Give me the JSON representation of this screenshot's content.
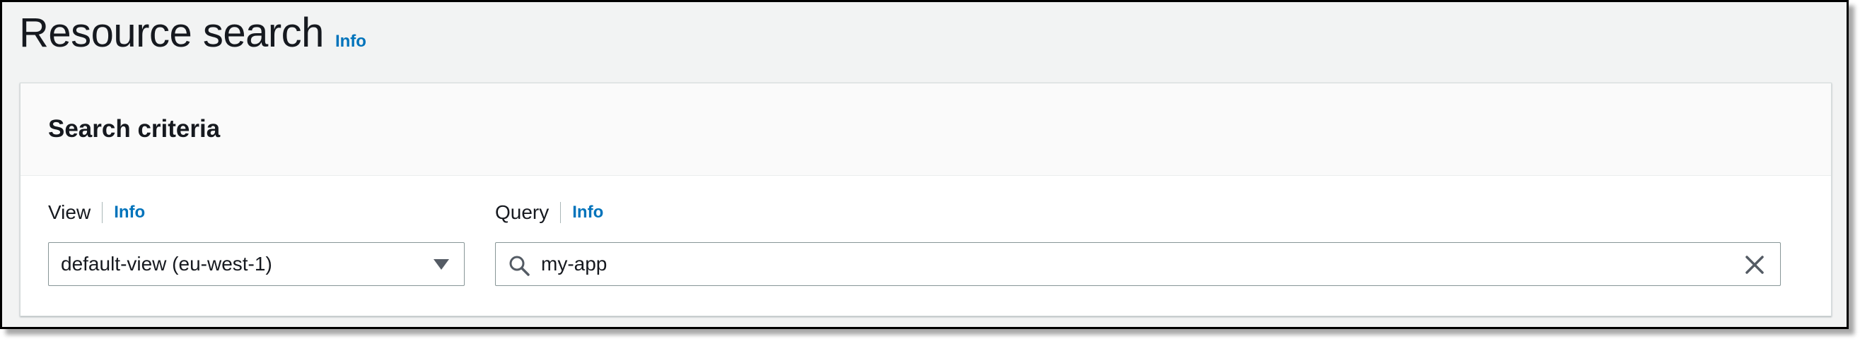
{
  "page": {
    "title": "Resource search",
    "info_label": "Info"
  },
  "search_criteria": {
    "title": "Search criteria",
    "view": {
      "label": "View",
      "info_label": "Info",
      "selected_value": "default-view (eu-west-1)",
      "icon": "caret-down-icon"
    },
    "query": {
      "label": "Query",
      "info_label": "Info",
      "value": "my-app",
      "search_icon": "search-icon",
      "clear_icon": "clear-icon"
    }
  },
  "colors": {
    "link": "#0073bb",
    "text": "#16191f",
    "page_background": "#f2f3f3",
    "input_border": "#879596"
  }
}
